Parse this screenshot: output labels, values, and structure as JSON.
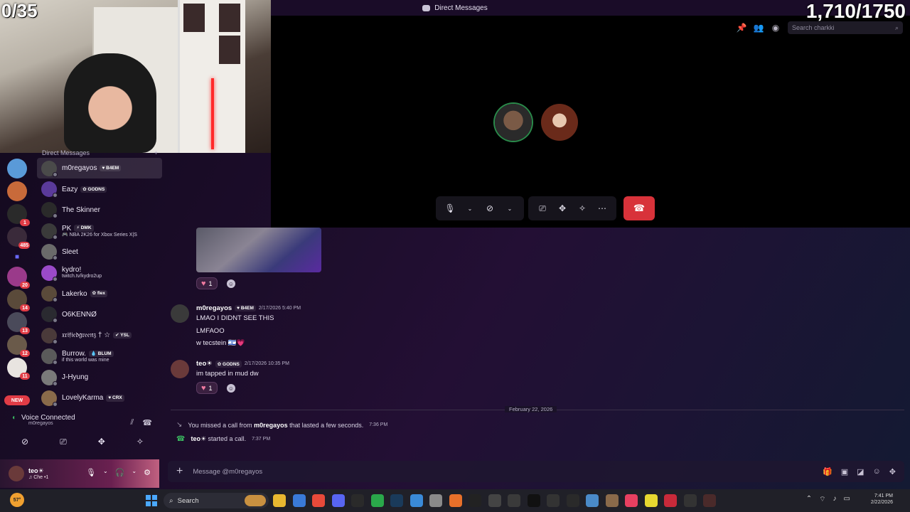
{
  "window": {
    "title": "Direct Messages"
  },
  "overlay": {
    "left_counter": "0/35",
    "right_counter": "1,710/1750"
  },
  "search": {
    "placeholder": "Search charkki"
  },
  "dm_header": {
    "label": "Direct Messages",
    "add": "+"
  },
  "servers": [
    {
      "badge": ""
    },
    {
      "badge": ""
    },
    {
      "badge": "1"
    },
    {
      "badge": "485"
    },
    {
      "badge": ""
    },
    {
      "badge": "20"
    },
    {
      "badge": "14"
    },
    {
      "badge": "13"
    },
    {
      "badge": "12"
    },
    {
      "badge": "11"
    }
  ],
  "new_badge": "NEW",
  "dms": [
    {
      "name": "m0regayos",
      "tag": "♥ B4EM",
      "sub": "",
      "color": "#4a4a4a",
      "active": true
    },
    {
      "name": "Eazy",
      "tag": "✿ GODNS",
      "sub": "",
      "color": "#5a3a9a",
      "active": false
    },
    {
      "name": "The Skinner",
      "tag": "",
      "sub": "",
      "color": "#2a2a2a",
      "active": false
    },
    {
      "name": "PK",
      "tag": "⚡ DMK",
      "sub": "🎮 NBA 2K26 for Xbox Series X|S",
      "color": "#3a3a3a",
      "active": false
    },
    {
      "name": "Sleet",
      "tag": "",
      "sub": "",
      "color": "#6a6a6a",
      "active": false
    },
    {
      "name": "kydro!",
      "tag": "",
      "sub": "twitch.tv/kydro2up",
      "color": "#9a4ac8",
      "active": false
    },
    {
      "name": "Lakerko",
      "tag": "✿ flex",
      "sub": "",
      "color": "#5a4a3a",
      "active": false
    },
    {
      "name": "O6KENNØ",
      "tag": "",
      "sub": "",
      "color": "#2a2a30",
      "active": false
    },
    {
      "name": "𝔵𝔯𝔦𝔣𝔦𝔢𝔡𝔤𝔯𝔢𝔢𝔫𝔷 † ☆",
      "tag": "✔ YSL",
      "sub": "",
      "color": "#4a3a3a",
      "active": false
    },
    {
      "name": "Burrow.",
      "tag": "💧 BLUM",
      "sub": "if this world was mine",
      "color": "#5a5a5a",
      "active": false
    },
    {
      "name": "J-Hyung",
      "tag": "",
      "sub": "",
      "color": "#7a7a7a",
      "active": false
    },
    {
      "name": "LovelyKarma",
      "tag": "♥ CRX",
      "sub": "",
      "color": "#8a6a4a",
      "active": false
    }
  ],
  "voice": {
    "title": "Voice Connected",
    "channel": "m0regayos"
  },
  "user": {
    "name": "teo☀",
    "status": "♫ Che •1"
  },
  "messages": [
    {
      "author": "m0regayos",
      "tag": "♥ B4EM",
      "time": "2/17/2026 5:40 PM",
      "lines": [
        "LMAO I DIDNT SEE THIS",
        "LMFAOO",
        "w tecstein 🇮🇱💗"
      ]
    },
    {
      "author": "teo☀",
      "tag": "✿ GODNS",
      "time": "2/17/2026 10:35 PM",
      "lines": [
        "im tapped in mud dw"
      ]
    }
  ],
  "reactions": [
    {
      "emoji": "♥",
      "count": "1"
    },
    {
      "emoji": "♥",
      "count": "1"
    }
  ],
  "date_divider": "February 22, 2026",
  "system": [
    {
      "pre": "You missed a call from ",
      "bold": "m0regayos",
      "post": " that lasted a few seconds.",
      "time": "7:36 PM"
    },
    {
      "pre": "",
      "bold": "teo☀",
      "post": " started a call.",
      "time": "7:37 PM"
    }
  ],
  "composer": {
    "placeholder": "Message @m0regayos"
  },
  "taskbar": {
    "weather": "57°",
    "search": "Search",
    "clock_time": "7:41 PM",
    "clock_date": "2/22/2026"
  },
  "colors": {
    "accent": "#5865f2",
    "danger": "#d8323a",
    "online": "#3ab860"
  }
}
